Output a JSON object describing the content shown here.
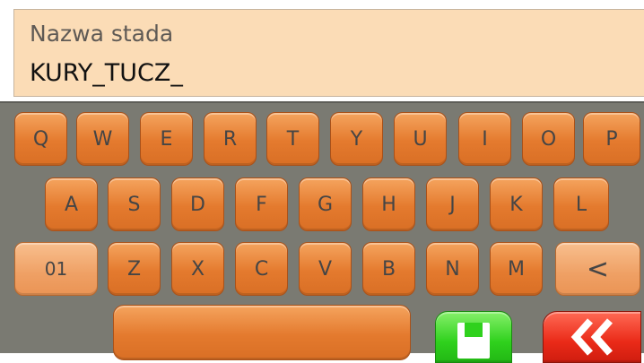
{
  "field": {
    "label": "Nazwa stada",
    "value": "KURY_TUCZ_"
  },
  "keyboard": {
    "row1": [
      "Q",
      "W",
      "E",
      "R",
      "T",
      "Y",
      "U",
      "I",
      "O",
      "P"
    ],
    "row2": [
      "A",
      "S",
      "D",
      "F",
      "G",
      "H",
      "J",
      "K",
      "L"
    ],
    "row3": [
      "Z",
      "X",
      "C",
      "V",
      "B",
      "N",
      "M"
    ],
    "mode_key": "01",
    "backspace_symbol": "<",
    "space_label": ""
  },
  "actions": {
    "save_icon": "floppy-disk-icon",
    "back_icon": "double-chevron-left-icon",
    "save_color": "#2fd11d",
    "back_color": "#ea2a18"
  },
  "colors": {
    "key": "#e47a2e",
    "key_light": "#efa064",
    "keyboard_bg": "#7a7a72",
    "field_bg": "#fbdcb6"
  }
}
